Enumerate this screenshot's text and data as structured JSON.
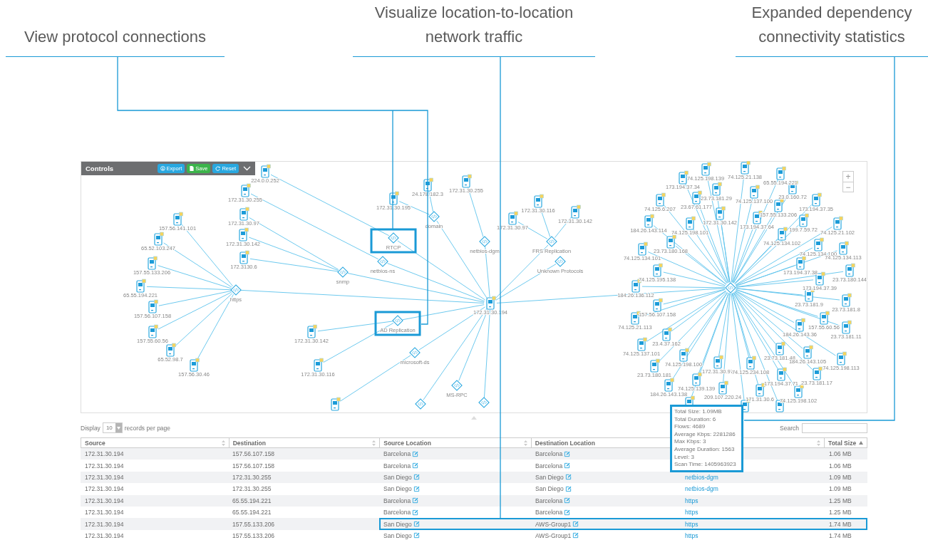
{
  "callouts": [
    {
      "text": "View protocol connections"
    },
    {
      "text": "Visualize location-to-location network traffic"
    },
    {
      "text": "Expanded dependency connectivity statistics"
    }
  ],
  "controls": {
    "title": "Controls",
    "buttons": [
      {
        "label": "Export",
        "kind": "export"
      },
      {
        "label": "Save",
        "kind": "save"
      },
      {
        "label": "Reset",
        "kind": "reset"
      }
    ]
  },
  "zoom_controls": [
    "+",
    "−"
  ],
  "graph": {
    "center_host": "172.31.30.194",
    "protocols": [
      {
        "label": "https",
        "kind": "protocol",
        "highlighted": false,
        "hosts": [
          {
            "kind": "device",
            "label": "157.56.141.101"
          },
          {
            "kind": "device",
            "label": "65.52.103.247"
          },
          {
            "kind": "device",
            "label": "157.55.133.206"
          },
          {
            "kind": "device",
            "label": "65.55.194.221"
          },
          {
            "kind": "device",
            "label": "157.56.107.158"
          },
          {
            "kind": "device",
            "label": "157.55.60.56"
          },
          {
            "kind": "device",
            "label": "65.52.98.7"
          },
          {
            "kind": "device",
            "label": "157.56.30.46"
          }
        ]
      },
      {
        "label": "snmp",
        "kind": "protocol",
        "highlighted": false,
        "hosts": [
          {
            "kind": "device",
            "label": "172.31.30.97"
          },
          {
            "kind": "device",
            "label": "172.31.30.142"
          },
          {
            "kind": "device",
            "label": "172.3130.6"
          }
        ]
      },
      {
        "label": "netbios-ns",
        "kind": "protocol",
        "highlighted": false,
        "hosts": [
          {
            "kind": "device",
            "label": "172.31.30.255"
          }
        ]
      },
      {
        "label": "RTCP",
        "kind": "protocol",
        "highlighted": true,
        "hosts": [
          {
            "kind": "device",
            "label": "224.0.0.252"
          }
        ]
      },
      {
        "label": "domain",
        "kind": "protocol",
        "highlighted": false,
        "hosts": [
          {
            "kind": "device",
            "label": "172.31.30.195"
          },
          {
            "kind": "device",
            "label": "24.178.182.3"
          }
        ]
      },
      {
        "label": "netbios-dgm",
        "kind": "protocol",
        "highlighted": false,
        "hosts": [
          {
            "kind": "device",
            "label": "172.31.30.255"
          }
        ]
      },
      {
        "label": "FRS Replication",
        "kind": "protocol",
        "highlighted": false,
        "hosts": [
          {
            "kind": "device",
            "label": "172.31.30.97"
          },
          {
            "kind": "device",
            "label": "172.31.30.116"
          },
          {
            "kind": "device",
            "label": "172.31.30.142"
          }
        ]
      },
      {
        "label": "Unknown Protocols",
        "kind": "protocol",
        "highlighted": false
      },
      {
        "label": "AD Replication",
        "kind": "protocol",
        "highlighted": true,
        "hosts": [
          {
            "kind": "device",
            "label": "172.31.30.142"
          },
          {
            "kind": "device",
            "label": "172.31.30.116"
          }
        ]
      },
      {
        "label": "microsoft-ds",
        "kind": "protocol",
        "highlighted": false,
        "hosts": [
          {
            "kind": "device"
          }
        ]
      },
      {
        "label": "MS-RPC",
        "kind": "protocol",
        "highlighted": false
      },
      {
        "kind": "protocol",
        "highlighted": false
      },
      {
        "kind": "protocol",
        "highlighted": false
      }
    ],
    "hub": {
      "hosts": [
        {
          "kind": "device",
          "label": "74.125.198.139"
        },
        {
          "kind": "device",
          "label": "74.125.21.138"
        },
        {
          "kind": "device",
          "label": "65.55.194.221"
        },
        {
          "kind": "device",
          "label": "173.194.37.34"
        },
        {
          "kind": "device",
          "label": "23.73.181.29"
        },
        {
          "kind": "device",
          "label": "74.125.137.100"
        },
        {
          "kind": "device",
          "label": "23.0.160.72"
        },
        {
          "kind": "device",
          "label": "74.125.6.207"
        },
        {
          "kind": "device",
          "label": "23.67.61.177"
        },
        {
          "kind": "device",
          "label": "173.194.37.35"
        },
        {
          "kind": "device",
          "label": "157.55.133.206"
        },
        {
          "kind": "device",
          "label": "184.26.143.114"
        },
        {
          "kind": "device",
          "label": "74.125.198.101"
        },
        {
          "kind": "device",
          "label": "172.31.30.142"
        },
        {
          "kind": "device",
          "label": "173.194.37.64"
        },
        {
          "kind": "device",
          "label": "199.7.59.72"
        },
        {
          "kind": "device",
          "label": "74.125.21.102"
        },
        {
          "kind": "device",
          "label": "74.125.134.102"
        },
        {
          "kind": "device",
          "label": "23.73.180.168"
        },
        {
          "kind": "device",
          "label": "74.125.134.101"
        },
        {
          "kind": "device",
          "label": "74.125.134.100"
        },
        {
          "kind": "device",
          "label": "74.125.134.113"
        },
        {
          "kind": "device",
          "label": "173.194.37.38"
        },
        {
          "kind": "device",
          "label": "74.125.195.138"
        },
        {
          "kind": "device",
          "label": "173.194.37.39"
        },
        {
          "kind": "device",
          "label": "23.73.180.144"
        },
        {
          "kind": "device",
          "label": "184.26.136.112"
        },
        {
          "kind": "device",
          "label": "23.73.181.9"
        },
        {
          "kind": "device",
          "label": "23.73.181.8"
        },
        {
          "kind": "device",
          "label": "157.56.107.158"
        },
        {
          "kind": "device",
          "label": "74.125.21.113"
        },
        {
          "kind": "device",
          "label": "157.55.60.56"
        },
        {
          "kind": "device",
          "label": "23.73.181.11"
        },
        {
          "kind": "device",
          "label": "23.4.37.162"
        },
        {
          "kind": "device",
          "label": "184.26.143.36"
        },
        {
          "kind": "device",
          "label": "74.125.137.101"
        },
        {
          "kind": "device",
          "label": "23.73.181.48"
        },
        {
          "kind": "device",
          "label": "184.26.143.105"
        },
        {
          "kind": "device",
          "label": "74.125.198.113"
        },
        {
          "kind": "device",
          "label": "74.125.198.100"
        },
        {
          "kind": "device",
          "label": "172.31.30.97"
        },
        {
          "kind": "device",
          "label": "74.125.234.108"
        },
        {
          "kind": "device",
          "label": "23.73.180.181"
        },
        {
          "kind": "device",
          "label": "173.194.37.71"
        },
        {
          "kind": "device",
          "label": "23.73.181.17"
        },
        {
          "kind": "device",
          "label": "74.125.139.139"
        },
        {
          "kind": "device",
          "label": "184.26.143.138"
        },
        {
          "kind": "device",
          "label": "209.107.220.24"
        },
        {
          "kind": "device",
          "label": "171.31.30.6"
        },
        {
          "kind": "device",
          "label": "74.125.198.102"
        },
        {
          "kind": "device"
        },
        {
          "kind": "device"
        },
        {
          "kind": "device"
        }
      ]
    }
  },
  "tooltip": {
    "lines": [
      "Total Size: 1.09MB",
      "Total Duration: 6",
      "Flows: 4689",
      "Average Kbps: 2281286",
      "Max Kbps: 3",
      "Average Duration: 1563",
      "Level: 3",
      "Scan Time: 1405963923"
    ]
  },
  "table": {
    "display_label": "Display",
    "page_size": "10",
    "records_label": "records per page",
    "search_label": "Search",
    "columns": [
      {
        "label": "Source",
        "sorted": false
      },
      {
        "label": "Destination",
        "sorted": false
      },
      {
        "label": "Source Location",
        "sorted": false
      },
      {
        "label": "Destination Location"
      },
      {
        "sorted": false
      },
      {
        "label": "Total Size",
        "sorted": true
      }
    ],
    "rows": [
      {
        "source": "172.31.30.194",
        "destination": "157.56.107.158",
        "source_location": "Barcelona",
        "destination_location": "Barcelona",
        "total_size": "1.06 MB",
        "highlighted": false
      },
      {
        "source": "172.31.30.194",
        "destination": "157.56.107.158",
        "source_location": "Barcelona",
        "destination_location": "Barcelona",
        "total_size": "1.06 MB",
        "highlighted": false
      },
      {
        "source": "172.31.30.194",
        "destination": "172.31.30.255",
        "source_location": "San Diego",
        "destination_location": "San Diego",
        "column_5": "netbios-dgm",
        "total_size": "1.09 MB",
        "highlighted": false
      },
      {
        "source": "172.31.30.194",
        "destination": "172.31.30.255",
        "source_location": "San Diego",
        "destination_location": "San Diego",
        "column_5": "netbios-dgm",
        "total_size": "1.09 MB",
        "highlighted": false
      },
      {
        "source": "172.31.30.194",
        "destination": "65.55.194.221",
        "source_location": "Barcelona",
        "destination_location": "Barcelona",
        "column_5": "https",
        "total_size": "1.25 MB",
        "highlighted": false
      },
      {
        "source": "172.31.30.194",
        "destination": "65.55.194.221",
        "source_location": "Barcelona",
        "destination_location": "Barcelona",
        "column_5": "https",
        "total_size": "1.25 MB",
        "highlighted": false
      },
      {
        "source": "172.31.30.194",
        "destination": "157.55.133.206",
        "source_location": "San Diego",
        "destination_location": "AWS-Group1",
        "column_5": "https",
        "total_size": "1.74 MB",
        "highlighted": true
      },
      {
        "source": "172.31.30.194",
        "destination": "157.55.133.206",
        "source_location": "San Diego",
        "destination_location": "AWS-Group1",
        "column_5": "https",
        "total_size": "1.74 MB",
        "highlighted": false
      }
    ]
  }
}
